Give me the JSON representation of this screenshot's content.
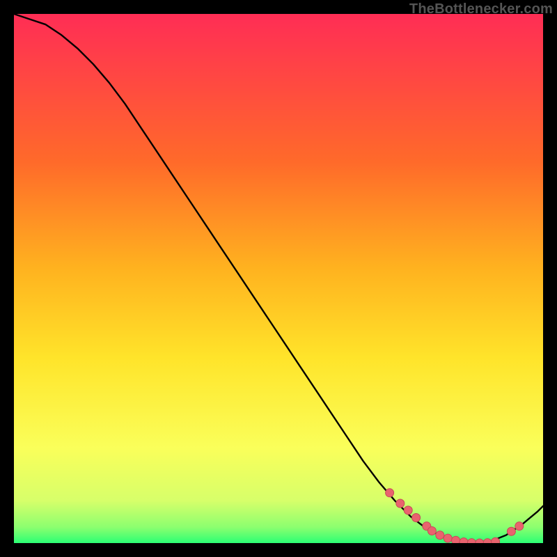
{
  "attribution": "TheBottlenecker.com",
  "colors": {
    "bg_black": "#000000",
    "grad_top": "#ff2d55",
    "grad_mid_upper": "#ff8a1f",
    "grad_mid": "#ffe42a",
    "grad_lower": "#f7ff6f",
    "grad_bottom": "#2bff74",
    "curve": "#000000",
    "marker_fill": "#e9636e",
    "marker_stroke": "#c64b56"
  },
  "chart_data": {
    "type": "line",
    "title": "",
    "xlabel": "",
    "ylabel": "",
    "xlim": [
      0,
      100
    ],
    "ylim": [
      0,
      100
    ],
    "grid": false,
    "legend": false,
    "series": [
      {
        "name": "bottleneck-curve",
        "x": [
          0,
          3,
          6,
          9,
          12,
          15,
          18,
          21,
          24,
          27,
          30,
          33,
          36,
          39,
          42,
          45,
          48,
          51,
          54,
          57,
          60,
          63,
          66,
          69,
          72,
          75,
          78,
          81,
          84,
          87,
          90,
          93,
          96,
          99,
          100
        ],
        "y": [
          100,
          99,
          98,
          96,
          93.5,
          90.5,
          87,
          83,
          78.5,
          74,
          69.5,
          65,
          60.5,
          56,
          51.5,
          47,
          42.5,
          38,
          33.5,
          29,
          24.5,
          20,
          15.5,
          11.5,
          8,
          5,
          2.7,
          1.2,
          0.3,
          0,
          0.3,
          1.5,
          3.5,
          6,
          7
        ]
      }
    ],
    "markers": {
      "name": "highlighted-points",
      "x": [
        71,
        73,
        74.5,
        76,
        78,
        79,
        80.5,
        82,
        83.5,
        85,
        86.5,
        88,
        89.5,
        91,
        94,
        95.5
      ],
      "y": [
        9.5,
        7.5,
        6.2,
        4.8,
        3.2,
        2.3,
        1.5,
        0.9,
        0.5,
        0.2,
        0.05,
        0,
        0.05,
        0.25,
        2.2,
        3.2
      ]
    }
  }
}
